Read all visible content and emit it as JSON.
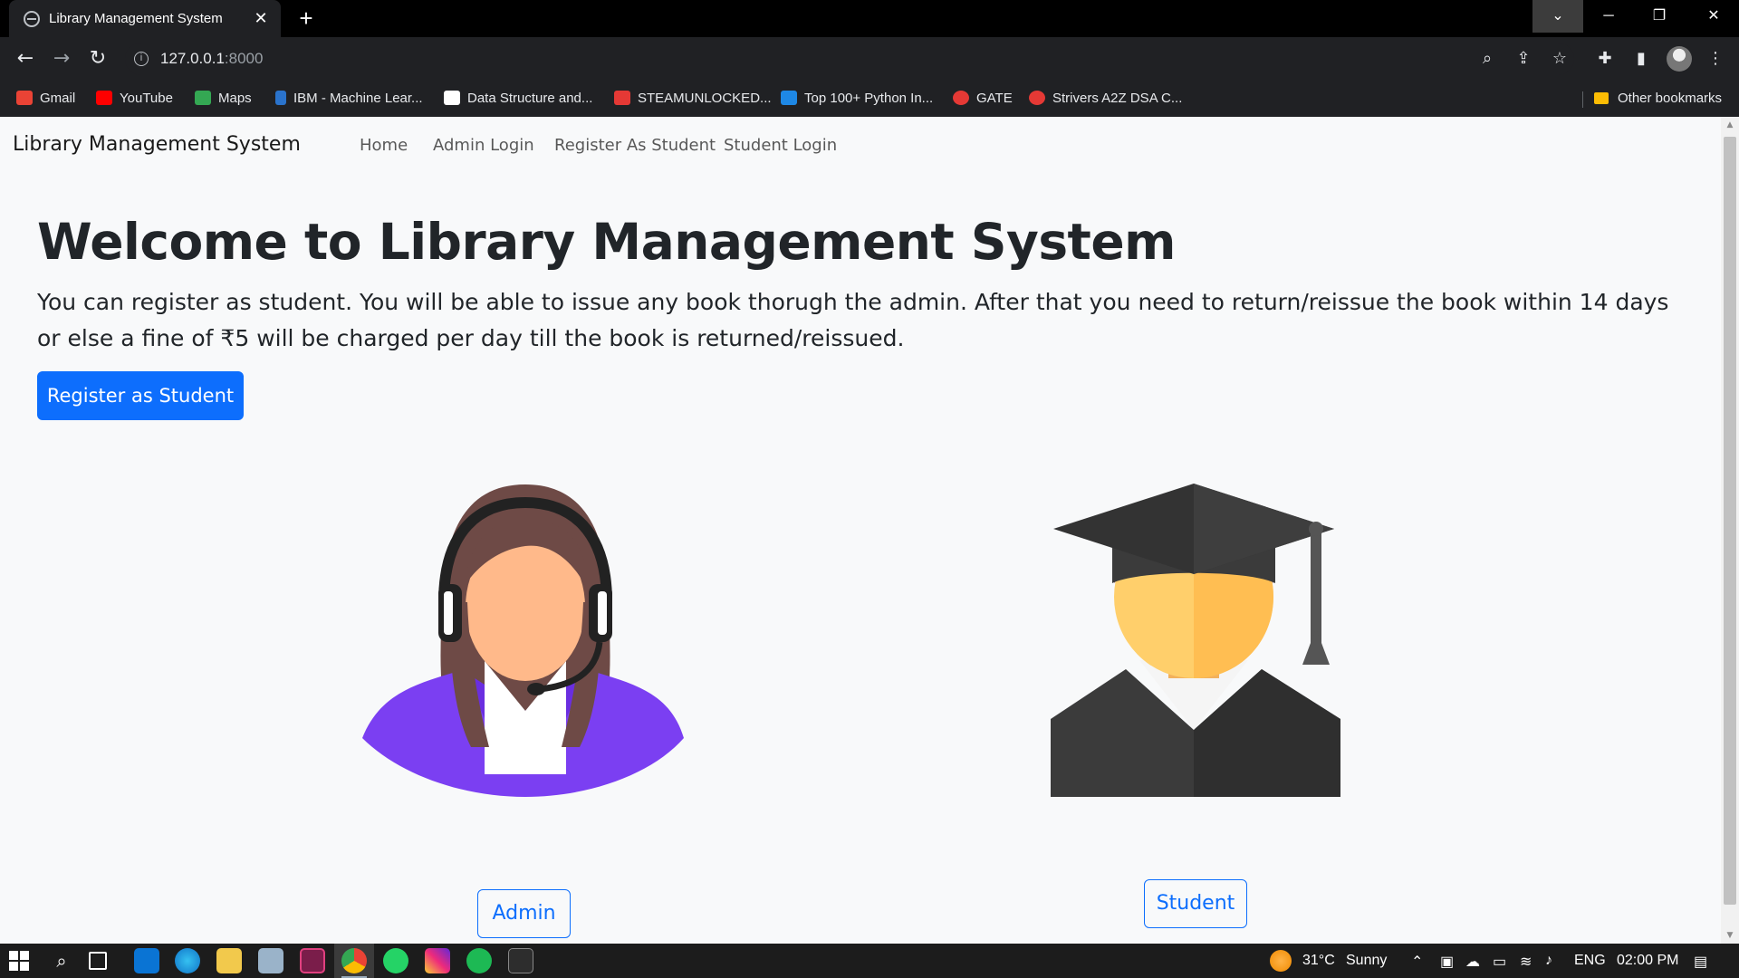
{
  "browser": {
    "tab_title": "Library Management System",
    "tab_close": "✕",
    "new_tab": "+",
    "url_host": "127.0.0.1",
    "url_port": ":8000",
    "bookmarks": [
      {
        "label": "Gmail",
        "icon": "gmail-icon",
        "color": "#ea4335"
      },
      {
        "label": "YouTube",
        "icon": "youtube-icon",
        "color": "#ff0000"
      },
      {
        "label": "Maps",
        "icon": "maps-icon",
        "color": "#34a853"
      },
      {
        "label": "IBM - Machine Lear...",
        "icon": "coursera-icon",
        "color": "#2a73cc"
      },
      {
        "label": "Data Structure and...",
        "icon": "diamond-icon",
        "color": "#ffffff"
      },
      {
        "label": "STEAMUNLOCKED...",
        "icon": "steam-icon",
        "color": "#e53935"
      },
      {
        "label": "Top 100+ Python In...",
        "icon": "edureka-icon",
        "color": "#1e88e5"
      },
      {
        "label": "GATE",
        "icon": "gate-icon",
        "color": "#e53935"
      },
      {
        "label": "Strivers A2Z DSA C...",
        "icon": "tuf-icon",
        "color": "#e53935"
      }
    ],
    "other_bookmarks": "Other bookmarks"
  },
  "navbar": {
    "brand": "Library Management System",
    "links": [
      "Home",
      "Admin Login",
      "Register As Student",
      "Student Login"
    ]
  },
  "hero": {
    "title": "Welcome to Library Management System",
    "lead": "You can register as student. You will be able to issue any book thorugh the admin. After that you need to return/reissue the book within 14 days or else a fine of ₹5 will be charged per day till the book is returned/reissued.",
    "button": "Register as Student"
  },
  "cards": {
    "admin_button": "Admin",
    "student_button": "Student"
  },
  "taskbar": {
    "weather_temp": "31°C",
    "weather_text": "Sunny",
    "language": "ENG",
    "time": "02:00 PM"
  },
  "colors": {
    "primary": "#0d6efd",
    "page_bg": "#f8f9fa",
    "chrome_bg": "#202124"
  }
}
